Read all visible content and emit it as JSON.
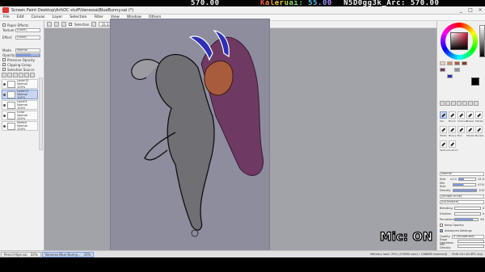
{
  "overlay": {
    "left_value": "570.00",
    "rainbow_label": "Kaleruai: 55.00",
    "right_label": "N5D0gg3k_Arc: 570.00"
  },
  "window": {
    "title": "Screen Paint Desktop\\Art\\OC stuff\\Vanessa\\BlueBunny.sai (*)",
    "minimize": "_",
    "maximize": "□",
    "close": "×"
  },
  "menu": [
    "File",
    "Edit",
    "Canvas",
    "Layer",
    "Selection",
    "Filter",
    "View",
    "Window",
    "Others"
  ],
  "toolbar": {
    "zoom": "33.33%",
    "angle": "+000°",
    "checkbox_label": "Selection",
    "stabilizer_label": "Stabilizer",
    "stabilizer_value": "7"
  },
  "left_panel": {
    "header": "Paper Effects",
    "texture_label": "Texture",
    "texture_value": "(none)",
    "effect_label": "Effect",
    "effect_value": "(none)",
    "mode_label": "Mode",
    "mode_value": "Normal",
    "opacity_label": "Opacity",
    "opacity_value": "100%",
    "checks": [
      "Preserve Opacity",
      "Clipping Group",
      "Selection Source"
    ],
    "layers": [
      {
        "name": "Layer12",
        "mode": "Normal",
        "opacity": "100%"
      },
      {
        "name": "Layer11",
        "mode": "Normal",
        "opacity": "100%"
      },
      {
        "name": "Layer3",
        "mode": "Normal",
        "opacity": "100%"
      },
      {
        "name": "Color",
        "mode": "Normal",
        "opacity": "100%"
      },
      {
        "name": "Sketch",
        "mode": "Normal",
        "opacity": "100%"
      }
    ],
    "selected_layer_index": 1
  },
  "right_panel": {
    "tool_labels": [
      "Select",
      "Lasso",
      "Magic",
      "Move",
      "Zoom",
      "Rotate",
      "Hand",
      "Spuit",
      "Pen",
      "Brush",
      "Airbrush",
      "Eraser",
      "Marker",
      "Water",
      "Binary",
      "Blur",
      "Marker",
      "Bucket",
      "Texture",
      "Custom"
    ],
    "selected_tool_index": 8,
    "blend_mode": "Normal",
    "size_label": "Size",
    "size_multiplier": "x1.0",
    "size_value": "12.0",
    "min_size_label": "Min Size",
    "min_size_value": "47%",
    "density_label": "Density",
    "density_value": "100",
    "shape_value": "[simple circle]",
    "texture_value": "[no texture]",
    "blending_label": "Blending",
    "blending_value": "0",
    "dilution_label": "Dilution",
    "dilution_value": "0",
    "persistence_label": "Persistence",
    "persistence_value": "80",
    "keep_opacity": "Keep Opacity",
    "advanced": "Advanced Settings",
    "quality_label": "Quality",
    "quality_value": "4 (Smoothest)",
    "edge_label": "Edge Hardness",
    "min_density_label": "Min Density",
    "max_dens_label": "Max Dens Prs",
    "hard_soft_label": "Hard <-> Soft",
    "press_label": "Press:",
    "press_options": [
      "Dens",
      "Size",
      "Blend"
    ],
    "fill_levels": {
      "size": 0.3,
      "min_size": 0.47,
      "density": 1.0,
      "blending": 0,
      "dilution": 0,
      "persistence": 0.8
    }
  },
  "tabs": [
    {
      "name": "Pencil Hips.sai",
      "zoom": "33%"
    },
    {
      "name": "Vanessa Blue Bunny...",
      "zoom": "33%"
    }
  ],
  "active_tab_index": 1,
  "status": {
    "memory": "Memory load: 25% (370MB used / 1368MB reserved)",
    "keys": "Shift Ctrl Alt SPC Any"
  },
  "mic_label": "Mic: ON",
  "colors": {
    "primary": "#000000",
    "secondary": "#ffffff",
    "canvas_bg": "#8d8d9e",
    "hair": "#6e3a63",
    "skin": "#a85c3c",
    "ears": "#2d2fb6"
  }
}
